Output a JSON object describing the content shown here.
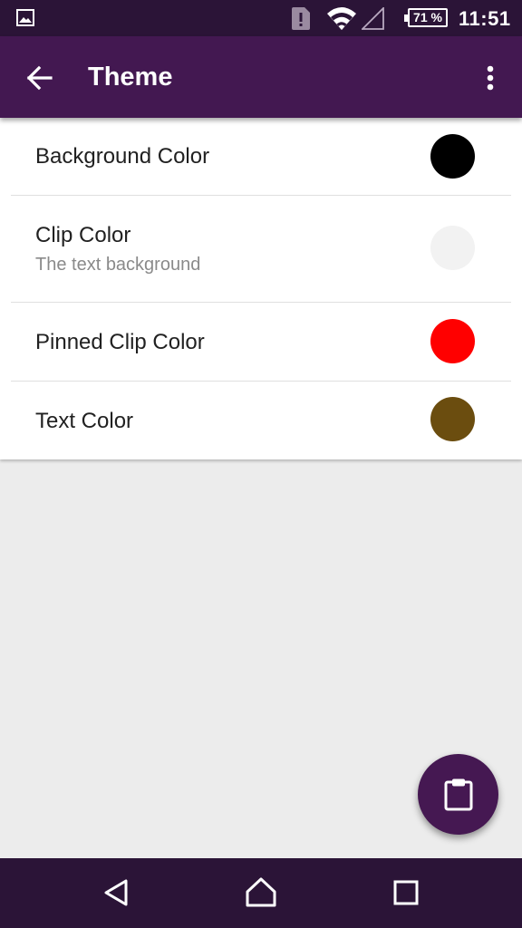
{
  "status_bar": {
    "battery_level": "71 %",
    "time": "11:51",
    "icons": [
      "gallery-notification-icon",
      "sim-alert-icon",
      "wifi-icon",
      "cell-signal-icon",
      "battery-icon"
    ]
  },
  "app_bar": {
    "title": "Theme",
    "icons": [
      "back-arrow-icon",
      "overflow-menu-icon"
    ]
  },
  "settings": [
    {
      "label": "Background Color",
      "summary": "",
      "color": "#000000"
    },
    {
      "label": "Clip Color",
      "summary": "The text background",
      "color": "#f2f2f2"
    },
    {
      "label": "Pinned Clip Color",
      "summary": "",
      "color": "#ff0000"
    },
    {
      "label": "Text Color",
      "summary": "",
      "color": "#6b4d0f"
    }
  ],
  "fab": {
    "icon": "clipboard-icon"
  },
  "nav_bar": {
    "icons": [
      "nav-back-icon",
      "nav-home-icon",
      "nav-recents-icon"
    ]
  },
  "colors": {
    "status_bar": "#2b1437",
    "app_bar": "#431851",
    "accent": "#451852",
    "background": "#ececec"
  }
}
